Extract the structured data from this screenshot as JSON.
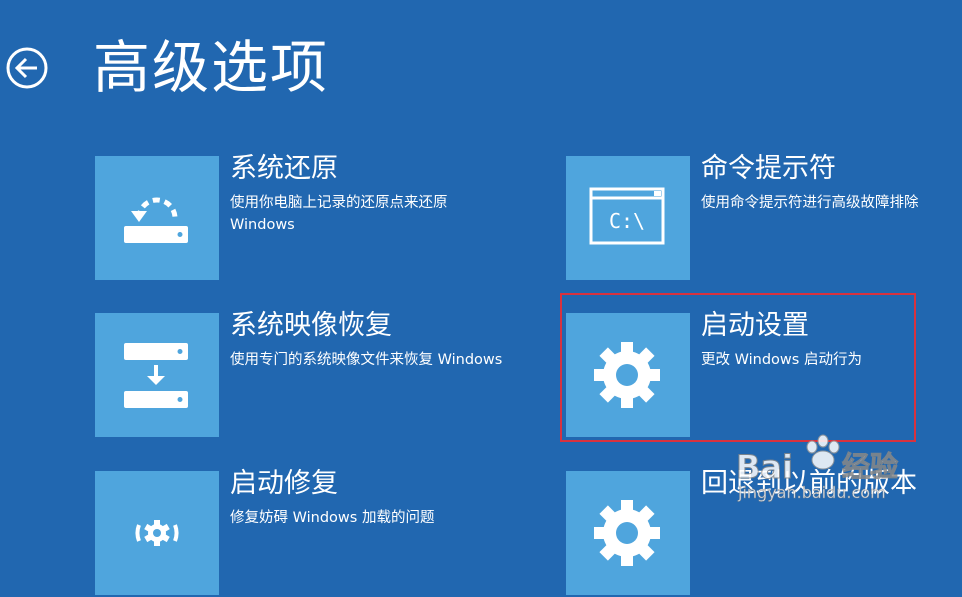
{
  "header": {
    "title": "高级选项",
    "back_icon": "back-arrow-icon"
  },
  "tiles": [
    {
      "id": "system-restore",
      "icon": "restore-icon",
      "title": "系统还原",
      "description": "使用你电脑上记录的还原点来还原 Windows"
    },
    {
      "id": "command-prompt",
      "icon": "command-prompt-icon",
      "title": "命令提示符",
      "description": "使用命令提示符进行高级故障排除",
      "icon_text": "C:\\"
    },
    {
      "id": "system-image-recovery",
      "icon": "image-recovery-icon",
      "title": "系统映像恢复",
      "description": "使用专门的系统映像文件来恢复 Windows"
    },
    {
      "id": "startup-settings",
      "icon": "gear-icon",
      "title": "启动设置",
      "description": "更改 Windows 启动行为",
      "highlighted": true
    },
    {
      "id": "startup-repair",
      "icon": "startup-repair-icon",
      "title": "启动修复",
      "description": "修复妨碍 Windows 加载的问题"
    },
    {
      "id": "go-back-previous-version",
      "icon": "gear-icon",
      "title": "回退到以前的版本",
      "description": ""
    }
  ],
  "colors": {
    "background": "#2167b0",
    "tile_icon_bg": "#4fa5dd",
    "highlight_border": "#d8323f",
    "text": "#ffffff"
  },
  "watermark": {
    "brand": "Bai",
    "brand_suffix": "经验",
    "url": "jingyan.baidu.com"
  }
}
